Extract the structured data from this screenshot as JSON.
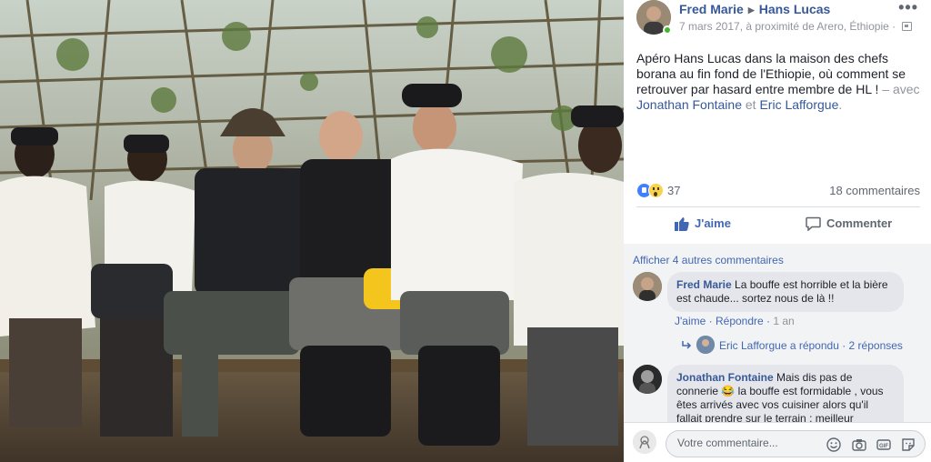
{
  "post": {
    "author": "Fred Marie",
    "target": "Hans Lucas",
    "date_place": "7 mars 2017, à proximité de Arero, Éthiopie",
    "more_icon": "ellipsis-icon",
    "caption": "Apéro Hans Lucas dans la maison des chefs borana au fin fond de l'Ethiopie, où comment se retrouver par hasard entre membre de HL !",
    "with_prefix": " – avec ",
    "tagged": [
      "Jonathan Fontaine",
      "Eric Lafforgue"
    ],
    "and_word": " et ",
    "end_dot": "."
  },
  "stats": {
    "reactions": [
      "like",
      "wow"
    ],
    "reaction_count": "37",
    "comments_count": "18 commentaires"
  },
  "actions": {
    "like_label": "J'aime",
    "comment_label": "Commenter"
  },
  "comments": {
    "show_more": "Afficher 4 autres commentaires",
    "items": [
      {
        "author": "Fred Marie",
        "text": "La bouffe est horrible et la bière est chaude... sortez nous de là !!",
        "like_label": "J'aime",
        "reply_label": "Répondre",
        "time": "1 an",
        "reply_summary_author": "Eric Lafforgue a répondu",
        "reply_summary_count": "2 réponses"
      },
      {
        "author": "Jonathan Fontaine",
        "text_1": "Mais dis pas de connerie",
        "emoji": "😂",
        "text_2": "la bouffe est formidable , vous êtes arrivés avec vos cuisiner alors qu'il fallait prendre sur le terrain : meilleur"
      }
    ]
  },
  "composer": {
    "placeholder": "Votre commentaire...",
    "icons": [
      "smiley-icon",
      "camera-icon",
      "gif-icon",
      "sticker-icon"
    ]
  },
  "colors": {
    "link": "#365899",
    "accent": "#4267b2",
    "muted": "#90949c"
  }
}
